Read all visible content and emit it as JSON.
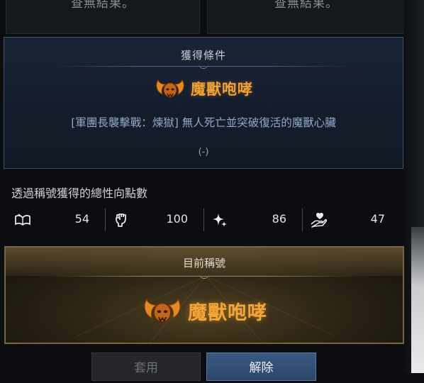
{
  "top_cards": {
    "left_text": "查無結果。",
    "right_text": "查無結果。"
  },
  "condition": {
    "heading": "獲得條件",
    "title_name": "魔獸咆哮",
    "description": "[軍團長襲擊戰：煉獄] 無人死亡並突破復活的魔獸心臟",
    "progress": "(-)"
  },
  "stats": {
    "heading": "透過稱號獲得的總性向點數",
    "items": [
      {
        "icon": "book-icon",
        "value": "54"
      },
      {
        "icon": "fist-icon",
        "value": "100"
      },
      {
        "icon": "sparkle-icon",
        "value": "86"
      },
      {
        "icon": "heart-hand-icon",
        "value": "47"
      }
    ]
  },
  "current": {
    "label": "目前稱號",
    "title_name": "魔獸咆哮"
  },
  "buttons": {
    "apply": "套用",
    "release": "解除"
  },
  "colors": {
    "title_accent": "#f0a035",
    "description": "#8fa8cc",
    "panel_border_blue": "#3e5070",
    "panel_border_gold": "#7a6638",
    "button_active": "#2b4568"
  }
}
